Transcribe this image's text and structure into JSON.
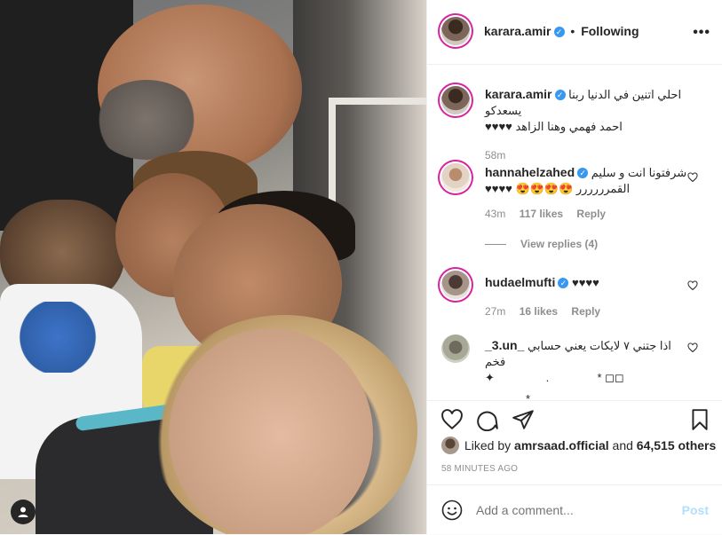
{
  "post": {
    "author": "karara.amir",
    "follow_status": "Following",
    "separator": "•",
    "more_label": "•••"
  },
  "caption": {
    "username": "karara.amir",
    "line1": "احلي اتنين في الدنيا ربنا يسعدكو",
    "line2": "احمد فهمي وهنا الزاهد ♥♥♥♥",
    "time": "58m"
  },
  "comments": [
    {
      "username": "hannahelzahed",
      "verified": true,
      "line1": "شرفتونا انت و سليم",
      "line2": "القمرررررر 😍😍😍😍 ♥♥♥♥",
      "time": "43m",
      "likes": "117 likes",
      "reply": "Reply",
      "view_replies": "View replies (4)"
    },
    {
      "username": "hudaelmufti",
      "verified": true,
      "line1": "♥♥♥♥",
      "time": "27m",
      "likes": "16 likes",
      "reply": "Reply"
    },
    {
      "username": "_3.un_",
      "verified": false,
      "line1": "اذا جتني ٧ لايكات يعني حسابي فخم",
      "line2": "✦                .               * ◻◻",
      "line3": "*"
    }
  ],
  "likes_line": {
    "prefix": "Liked by",
    "user": "amrsaad.official",
    "middle": "and",
    "others": "64,515 others"
  },
  "timestamp": "58 MINUTES AGO",
  "add_comment": {
    "placeholder": "Add a comment...",
    "post_label": "Post"
  },
  "colors": {
    "verified": "#3897f0",
    "post_disabled": "#b2dffc",
    "meta": "#8e8e8e"
  }
}
